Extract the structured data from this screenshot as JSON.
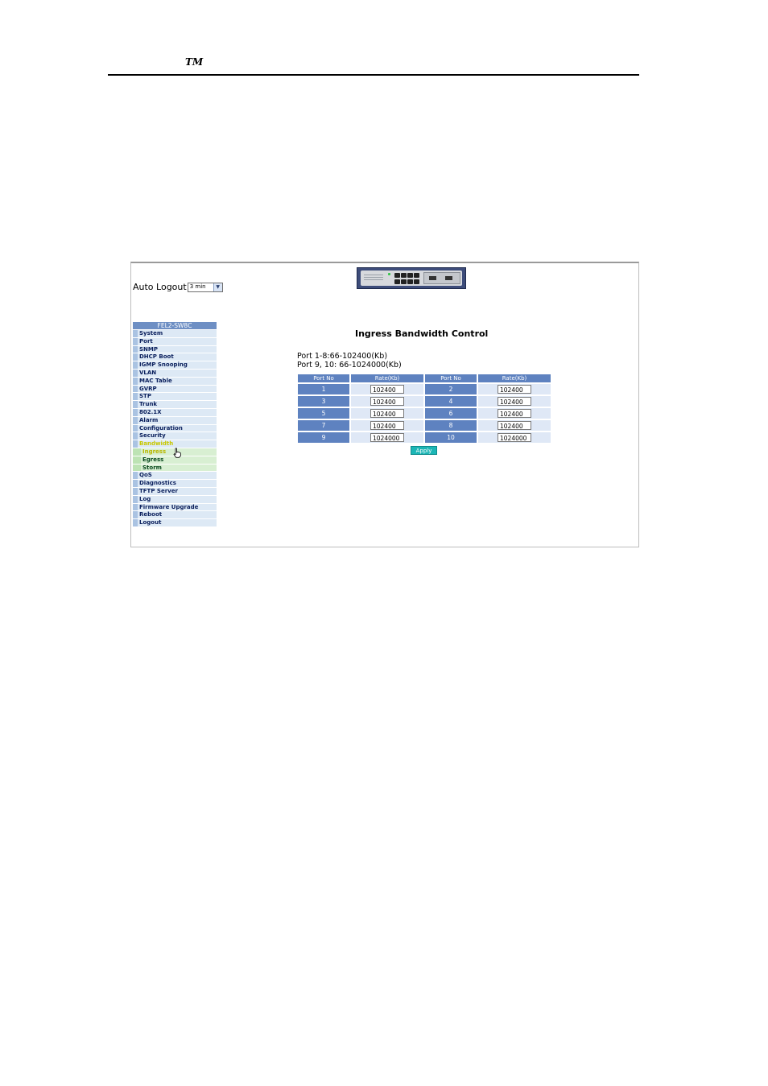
{
  "header": {
    "trademark": "TM"
  },
  "auto_logout": {
    "label": "Auto Logout",
    "value": "3 min",
    "arrow": "▼"
  },
  "menu": {
    "title": "FEL2-SW8C",
    "items": [
      "System",
      "Port",
      "SNMP",
      "DHCP Boot",
      "IGMP Snooping",
      "VLAN",
      "MAC Table",
      "GVRP",
      "STP",
      "Trunk",
      "802.1X",
      "Alarm",
      "Configuration",
      "Security",
      "Bandwidth"
    ],
    "sub_items": [
      "Ingress",
      "Egress",
      "Storm"
    ],
    "items_after": [
      "QoS",
      "Diagnostics",
      "TFTP Server",
      "Log",
      "Firmware Upgrade",
      "Reboot",
      "Logout"
    ]
  },
  "main": {
    "title": "Ingress Bandwidth Control",
    "range1": "Port 1-8:66-102400(Kb)",
    "range2": "Port 9, 10: 66-1024000(Kb)",
    "headers": [
      "Port No",
      "Rate(Kb)",
      "Port No",
      "Rate(Kb)"
    ],
    "rows": [
      {
        "p1": "1",
        "r1": "102400",
        "p2": "2",
        "r2": "102400"
      },
      {
        "p1": "3",
        "r1": "102400",
        "p2": "4",
        "r2": "102400"
      },
      {
        "p1": "5",
        "r1": "102400",
        "p2": "6",
        "r2": "102400"
      },
      {
        "p1": "7",
        "r1": "102400",
        "p2": "8",
        "r2": "102400"
      },
      {
        "p1": "9",
        "r1": "1024000",
        "p2": "10",
        "r2": "1024000"
      }
    ],
    "apply_label": "Apply"
  },
  "colors": {
    "menu_header": "#6e8fc4",
    "port_cell": "#5e82c0",
    "rate_cell": "#dfe8f6",
    "apply": "#1cb6b6",
    "active_menu": "#c8c800"
  },
  "icons": {
    "cursor": "hand-pointer-icon",
    "dropdown": "chevron-down-icon"
  }
}
